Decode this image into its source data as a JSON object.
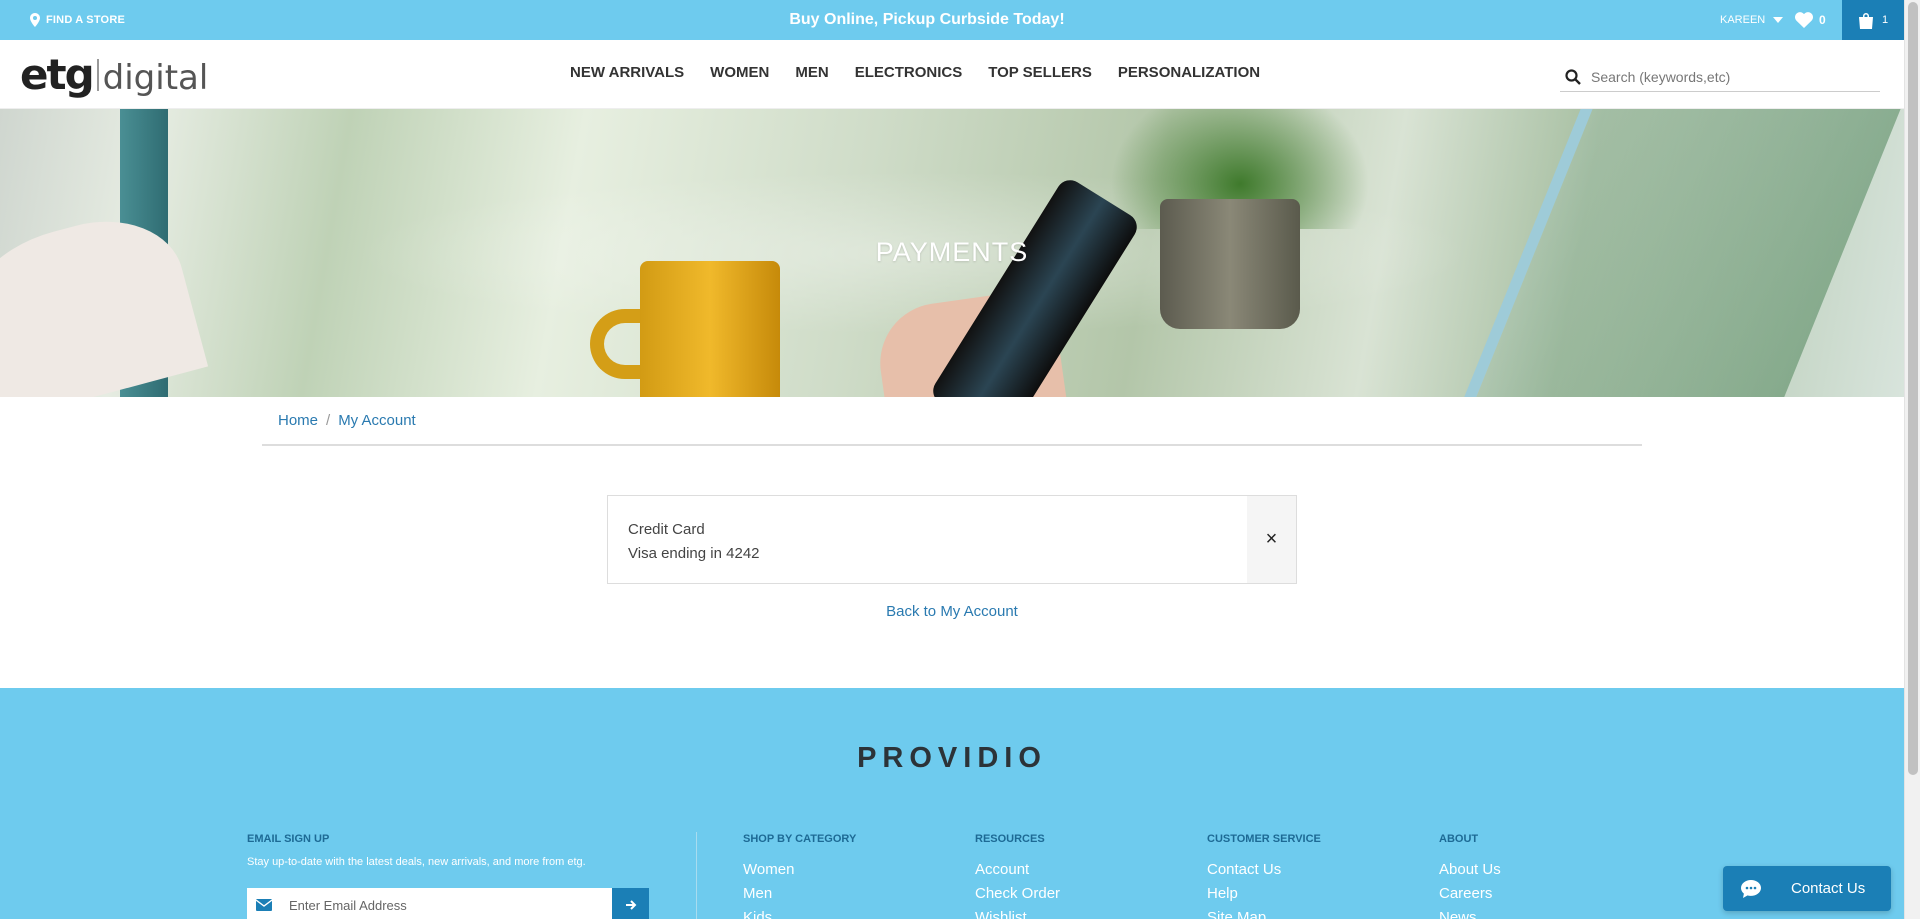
{
  "topbar": {
    "find_store": "FIND A STORE",
    "promo": "Buy Online, Pickup Curbside Today!",
    "user": "KAREEN",
    "wishlist_count": "0",
    "cart_count": "1"
  },
  "header": {
    "logo_main": "etg",
    "logo_sub": "digital",
    "nav": [
      "NEW ARRIVALS",
      "WOMEN",
      "MEN",
      "ELECTRONICS",
      "TOP SELLERS",
      "PERSONALIZATION"
    ],
    "search_placeholder": "Search (keywords,etc)"
  },
  "hero": {
    "title": "PAYMENTS"
  },
  "breadcrumb": {
    "home": "Home",
    "separator": "/",
    "current": "My Account"
  },
  "payment": {
    "type": "Credit Card",
    "description": "Visa ending in 4242",
    "remove": "×"
  },
  "back_link": "Back to My Account",
  "footer": {
    "brand": "PROVIDIO",
    "signup_heading": "EMAIL SIGN UP",
    "signup_text": "Stay up-to-date with the latest deals, new arrivals, and more from etg.",
    "email_placeholder": "Enter Email Address",
    "columns": [
      {
        "heading": "SHOP BY CATEGORY",
        "links": [
          "Women",
          "Men",
          "Kids"
        ]
      },
      {
        "heading": "RESOURCES",
        "links": [
          "Account",
          "Check Order",
          "Wishlist"
        ]
      },
      {
        "heading": "CUSTOMER SERVICE",
        "links": [
          "Contact Us",
          "Help",
          "Site Map"
        ]
      },
      {
        "heading": "ABOUT",
        "links": [
          "About Us",
          "Careers",
          "News"
        ]
      }
    ]
  },
  "chat": {
    "label": "Contact Us"
  },
  "colors": {
    "accent": "#6ecbee",
    "accent_dark": "#1b7fb6",
    "link": "#2a7ab0"
  },
  "icons": [
    "map-pin-icon",
    "chevron-down-icon",
    "heart-icon",
    "shopping-bag-icon",
    "search-icon",
    "close-icon",
    "mail-icon",
    "arrow-right-icon",
    "chat-bubble-icon"
  ]
}
